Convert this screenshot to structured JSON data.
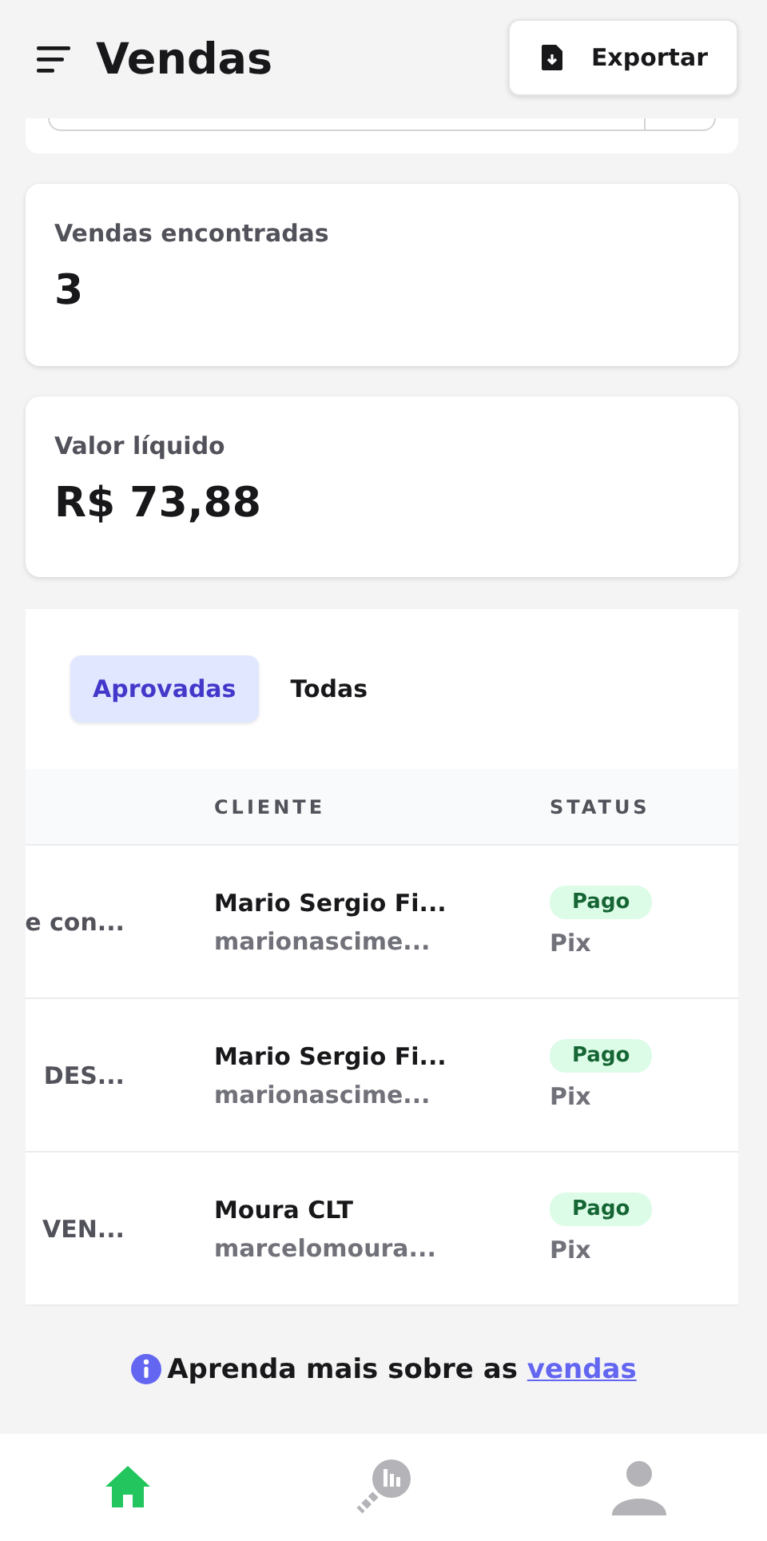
{
  "header": {
    "title": "Vendas",
    "export_button": "Exportar"
  },
  "stats": [
    {
      "label": "Vendas encontradas",
      "value": "3"
    },
    {
      "label": "Valor líquido",
      "value": "R$ 73,88"
    }
  ],
  "tabs": [
    {
      "label": "Aprovadas",
      "selected": true
    },
    {
      "label": "Todas",
      "selected": false
    }
  ],
  "table": {
    "columns": [
      "CLIENTE",
      "STATUS"
    ],
    "rows": [
      {
        "column_1": "e con...",
        "client_name": "Mario Sergio Fi...",
        "client_email": "marionascime...",
        "status": "Pago",
        "method": "Pix"
      },
      {
        "column_1": "DES...",
        "client_name": "Mario Sergio Fi...",
        "client_email": "marionascime...",
        "status": "Pago",
        "method": "Pix"
      },
      {
        "column_1": "VEN...",
        "client_name": "Moura CLT",
        "client_email": "marcelomoura...",
        "status": "Pago",
        "method": "Pix"
      }
    ]
  },
  "help": {
    "text": "Aprenda mais sobre as",
    "link": "vendas"
  },
  "bottom_nav": [
    {
      "kind": "home",
      "selected": true
    },
    {
      "kind": "reports",
      "selected": false
    },
    {
      "kind": "profile",
      "selected": false
    }
  ]
}
